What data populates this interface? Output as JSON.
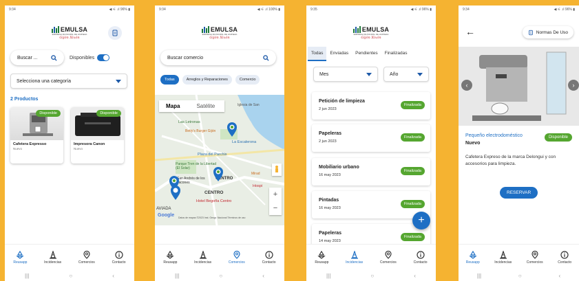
{
  "logo": {
    "name": "EMULSA",
    "sub": "EMPRESA MUNICIPAL DE LIMPIEZA",
    "script": "Gijón Xixón"
  },
  "nav": [
    {
      "label": "Reusapp",
      "icon": "recycle-icon"
    },
    {
      "label": "Incidencias",
      "icon": "cone-icon"
    },
    {
      "label": "Comercios",
      "icon": "shop-pin-icon"
    },
    {
      "label": "Contacto",
      "icon": "info-icon"
    }
  ],
  "screen1": {
    "status_time": "9:34",
    "status_right": "◀ ⚟ .ıl 96% ▮",
    "search_placeholder": "Buscar ...",
    "toggle_label": "Disponibles",
    "category_placeholder": "Selecciona una categoría",
    "count": "2 Productos",
    "products": [
      {
        "title": "Cafetera Expresso",
        "sub": "Nuevo",
        "badge": "Disponible"
      },
      {
        "title": "Impresora Canon",
        "sub": "Nuevo",
        "badge": "Disponible"
      }
    ]
  },
  "screen2": {
    "status_time": "9:34",
    "status_right": "◀ ⚟ .ıl 100% ▮",
    "search_placeholder": "Buscar comercio",
    "chips": [
      "Todas",
      "Arreglos y Reparaciones",
      "Comercio"
    ],
    "map_tabs": [
      "Mapa",
      "Satélite"
    ],
    "map_labels": {
      "iglesia": "Iglesia de San",
      "letronas": "Las Letronas",
      "betty": "Betty's Burger Gijón",
      "escalerona": "La Escalerona",
      "parchis": "Plaza del Parchis",
      "parque": "Parque Tren de la Libertad (El Solar)",
      "andres": "San Andrés de los Tacones",
      "centro": "CENTRO",
      "centro2": "CENTRO",
      "hotel": "Hotel Begoña Centro",
      "hospital": "Hospi",
      "mirad": "Mirad",
      "aviada": "AVIADA",
      "google": "Google",
      "attribution": "Datos de mapas ©2023 Inst. Geogr. Nacional   Términos de uso"
    }
  },
  "screen3": {
    "status_time": "9:35",
    "status_right": "◀ ⚟ .ıl 96% ▮",
    "tabs": [
      "Todas",
      "Enviadas",
      "Pendientes",
      "Finalizadas"
    ],
    "month_placeholder": "Mes",
    "year_placeholder": "Año",
    "requests": [
      {
        "title": "Petición de limpieza",
        "date": "2 jun 2023",
        "status": "Finalizada"
      },
      {
        "title": "Papeleras",
        "date": "2 jun 2023",
        "status": "Finalizada"
      },
      {
        "title": "Mobiliario urbano",
        "date": "16 may 2023",
        "status": "Finalizada"
      },
      {
        "title": "Pintadas",
        "date": "16 may 2023",
        "status": "Finalizada"
      },
      {
        "title": "Papeleras",
        "date": "14 may 2023",
        "status": "Finalizada"
      }
    ],
    "fab_label": "+"
  },
  "screen4": {
    "status_time": "9:34",
    "status_right": "◀ ⚟ .ıl 96% ▮",
    "norms_label": "Normas De Uso",
    "category": "Pequeño electrodoméstico",
    "condition": "Nuevo",
    "badge": "Disponible",
    "description": "Cafetera Expreso de la marca Delongui y con accesorios para limpieza.",
    "reserve_label": "RESERVAR"
  },
  "colors": {
    "accent": "#1e6fc4",
    "success": "#55a630",
    "background": "#f5b331"
  }
}
